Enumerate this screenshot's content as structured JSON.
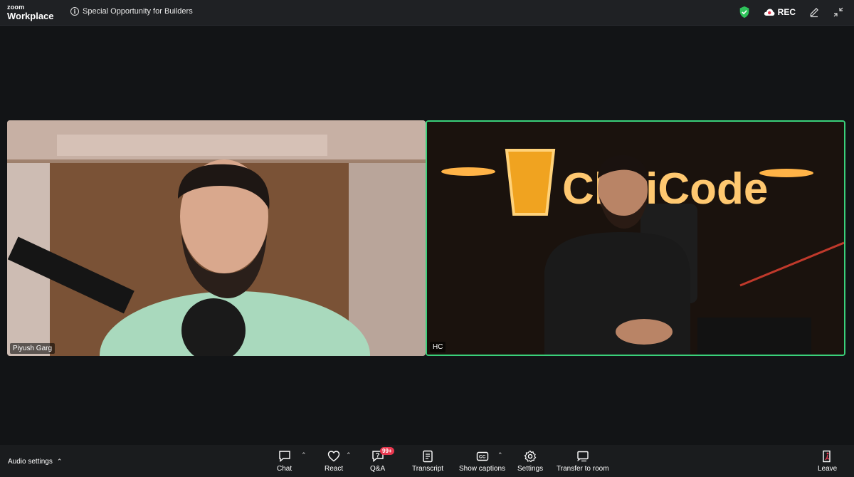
{
  "app": {
    "brand_small": "zoom",
    "brand_name": "Workplace"
  },
  "meeting": {
    "title": "Special Opportunity for Builders",
    "rec_label": "REC"
  },
  "participants": [
    {
      "name": "Piyush Garg"
    },
    {
      "name": "HC"
    }
  ],
  "toolbar": {
    "audio_settings": "Audio settings",
    "chat": "Chat",
    "react": "React",
    "qa": "Q&A",
    "qa_badge": "99+",
    "transcript": "Transcript",
    "captions": "Show captions",
    "settings": "Settings",
    "transfer": "Transfer to room",
    "leave": "Leave"
  },
  "colors": {
    "active_speaker": "#3ad07a",
    "security_shield": "#2ec25a",
    "leave_red": "#e8384f"
  }
}
